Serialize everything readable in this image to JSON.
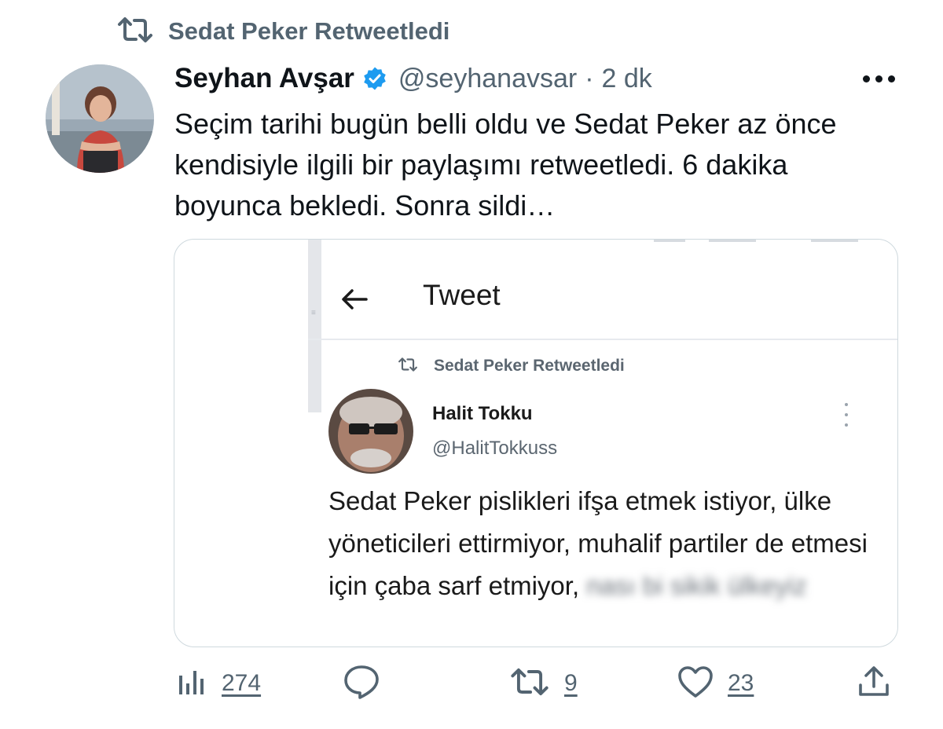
{
  "retweet_header": {
    "label": "Sedat Peker Retweetledi",
    "icon": "retweet-icon"
  },
  "tweet": {
    "author_name": "Seyhan Avşar",
    "verified": true,
    "handle": "@seyhanavsar",
    "separator": "·",
    "time": "2 dk",
    "text": "Seçim tarihi bugün belli oldu ve Sedat Peker az önce kendisiyle ilgili bir paylaşımı retweetledi. 6 dakika boyunca bekledi. Sonra sildi…"
  },
  "media": {
    "screen_title": "Tweet",
    "retweet_label": "Sedat Peker Retweetledi",
    "author_name": "Halit Tokku",
    "handle": "@HalitTokkuss",
    "body_visible": "Sedat Peker pislikleri ifşa etmek istiyor, ülke yöneticileri ettirmiyor, muhalif partiler de etmesi için çaba sarf etmiyor,",
    "body_blurred": "nası bi sikik ülkeyiz"
  },
  "actions": {
    "views": "274",
    "replies": "",
    "retweets": "9",
    "likes": "23"
  },
  "colors": {
    "text": "#0f1419",
    "muted": "#536471",
    "verified": "#1d9bf0",
    "border": "#cfd9de"
  }
}
